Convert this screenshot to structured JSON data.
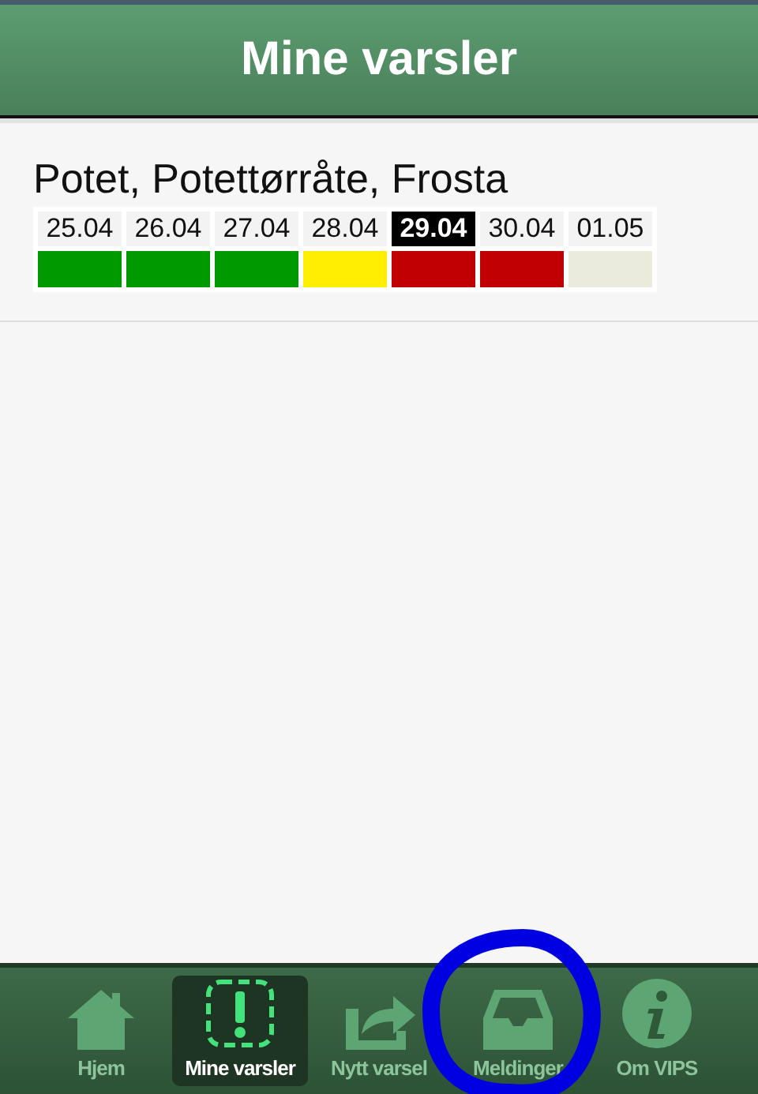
{
  "header": {
    "title": "Mine varsler"
  },
  "warnings": [
    {
      "title": "Potet, Potettørråte, Frosta",
      "days": [
        {
          "date": "25.04",
          "color": "#009900",
          "selected": false
        },
        {
          "date": "26.04",
          "color": "#009900",
          "selected": false
        },
        {
          "date": "27.04",
          "color": "#009900",
          "selected": false
        },
        {
          "date": "28.04",
          "color": "#ffee00",
          "selected": false
        },
        {
          "date": "29.04",
          "color": "#c00000",
          "selected": true
        },
        {
          "date": "30.04",
          "color": "#c00000",
          "selected": false
        },
        {
          "date": "01.05",
          "color": "#ebebdd",
          "selected": false
        }
      ]
    }
  ],
  "nav": [
    {
      "label": "Hjem",
      "selected": false
    },
    {
      "label": "Mine varsler",
      "selected": true
    },
    {
      "label": "Nytt varsel",
      "selected": false
    },
    {
      "label": "Meldinger",
      "selected": false
    },
    {
      "label": "Om VIPS",
      "selected": false
    }
  ]
}
